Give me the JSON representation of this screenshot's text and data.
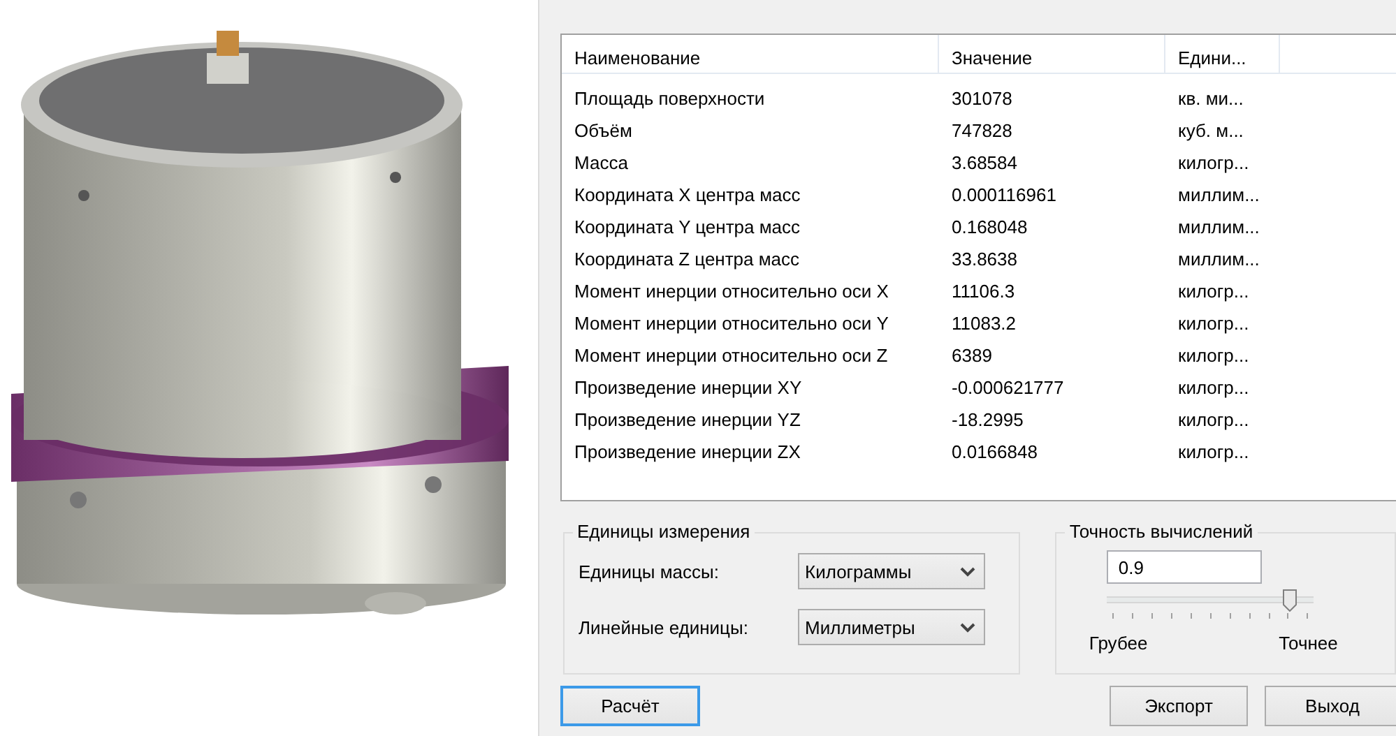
{
  "table": {
    "columns": [
      "Наименование",
      "Значение",
      "Едини..."
    ],
    "rows": [
      [
        "Площадь поверхности",
        "301078",
        "кв. ми..."
      ],
      [
        "Объём",
        "747828",
        "куб. м..."
      ],
      [
        "Масса",
        "3.68584",
        "килогр..."
      ],
      [
        "Координата X центра масс",
        "0.000116961",
        "миллим..."
      ],
      [
        "Координата Y центра масс",
        "0.168048",
        "миллим..."
      ],
      [
        "Координата Z центра масс",
        "33.8638",
        "миллим..."
      ],
      [
        "Момент инерции относительно оси X",
        "11106.3",
        "килогр..."
      ],
      [
        "Момент инерции относительно оси Y",
        "11083.2",
        "килогр..."
      ],
      [
        "Момент инерции относительно оси Z",
        "6389",
        "килогр..."
      ],
      [
        "Произведение инерции XY",
        "-0.000621777",
        "килогр..."
      ],
      [
        "Произведение инерции YZ",
        "-18.2995",
        "килогр..."
      ],
      [
        "Произведение инерции ZX",
        "0.0166848",
        "килогр..."
      ]
    ]
  },
  "units_group": {
    "title": "Единицы измерения",
    "fields": [
      {
        "label": "Единицы массы:",
        "value": "Килограммы"
      },
      {
        "label": "Линейные единицы:",
        "value": "Миллиметры"
      }
    ]
  },
  "precision_group": {
    "title": "Точность вычислений",
    "value": "0.9",
    "level": 0.88,
    "min_label": "Грубее",
    "max_label": "Точнее"
  },
  "buttons": [
    {
      "label": "Расчёт",
      "focused": true
    },
    {
      "label": "Экспорт",
      "focused": false
    },
    {
      "label": "Выход",
      "focused": false
    }
  ]
}
